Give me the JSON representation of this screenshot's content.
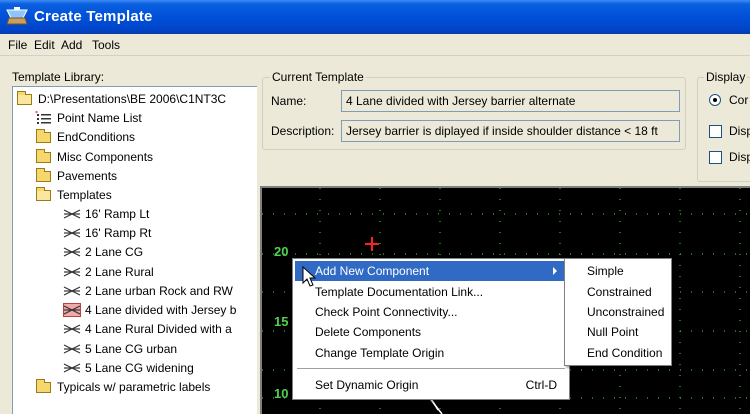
{
  "window": {
    "title": "Create Template",
    "icon": "template-app-icon"
  },
  "menu": [
    "File",
    "Edit",
    "Add",
    "Tools"
  ],
  "library": {
    "label": "Template Library:",
    "items": [
      {
        "label": "D:\\Presentations\\BE 2006\\C1NT3C",
        "icon": "folder-open-icon"
      },
      {
        "label": "Point Name List",
        "icon": "point-list-icon"
      },
      {
        "label": "EndConditions",
        "icon": "folder-icon"
      },
      {
        "label": "Misc Components",
        "icon": "folder-icon"
      },
      {
        "label": "Pavements",
        "icon": "folder-icon"
      },
      {
        "label": "Templates",
        "icon": "folder-open-icon"
      },
      {
        "label": "16' Ramp Lt",
        "icon": "template-icon"
      },
      {
        "label": "16' Ramp Rt",
        "icon": "template-icon"
      },
      {
        "label": "2 Lane CG",
        "icon": "template-icon"
      },
      {
        "label": "2 Lane Rural",
        "icon": "template-icon"
      },
      {
        "label": "2 Lane urban Rock and RW",
        "icon": "template-icon"
      },
      {
        "label": "4 Lane divided with Jersey b",
        "icon": "template-selected-icon"
      },
      {
        "label": "4 Lane Rural Divided with a",
        "icon": "template-icon"
      },
      {
        "label": "5 Lane CG urban",
        "icon": "template-icon"
      },
      {
        "label": "5 Lane CG widening",
        "icon": "template-icon"
      },
      {
        "label": "Typicals w/ parametric labels",
        "icon": "folder-icon"
      }
    ]
  },
  "current_template": {
    "legend": "Current Template",
    "name_label": "Name:",
    "name_value": "4 Lane divided with Jersey barrier alternate",
    "description_label": "Description:",
    "description_value": "Jersey barrier is diplayed if inside shoulder distance < 18 ft"
  },
  "display": {
    "legend": "Display",
    "option1": "Cor",
    "option2": "Disp",
    "option3": "Disp"
  },
  "canvas": {
    "y_labels": [
      "20",
      "15",
      "10"
    ],
    "grid_color": "#4cd44c",
    "origin_marker_color": "#ff2020"
  },
  "context_menu": {
    "items": [
      {
        "label": "Add New Component",
        "highlighted": true,
        "submenu": true
      },
      {
        "label": "Template Documentation Link..."
      },
      {
        "label": "Check Point Connectivity..."
      },
      {
        "label": "Delete Components"
      },
      {
        "label": "Change Template Origin"
      }
    ],
    "footer": {
      "label": "Set Dynamic Origin",
      "shortcut": "Ctrl-D"
    }
  },
  "submenu": [
    "Simple",
    "Constrained",
    "Unconstrained",
    "Null Point",
    "End Condition"
  ],
  "colors": {
    "titlebar": "#0050d8",
    "highlight": "#316ac5",
    "canvas": "#000000"
  }
}
